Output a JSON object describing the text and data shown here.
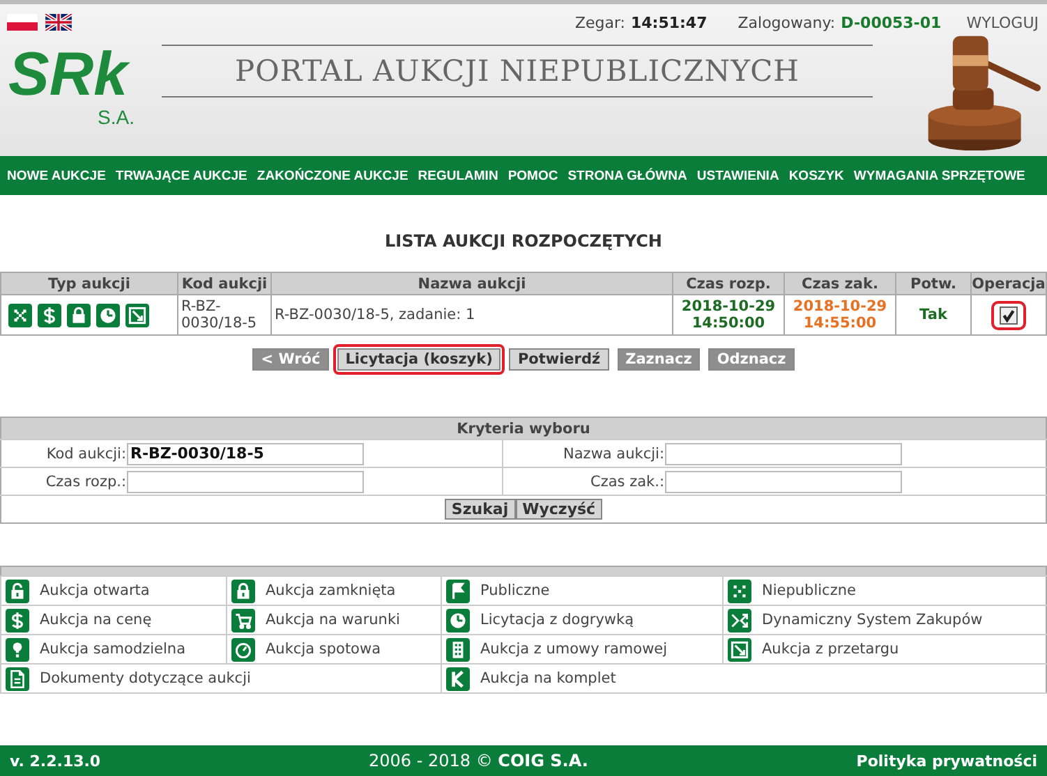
{
  "header": {
    "clock_label": "Zegar:",
    "clock": "14:51:47",
    "user_label": "Zalogowany:",
    "user": "D-00053-01",
    "logout": "WYLOGUJ",
    "logo": {
      "mark": "SRk",
      "suffix": "S.A."
    },
    "title": "PORTAL AUKCJI NIEPUBLICZNYCH"
  },
  "nav": [
    "NOWE AUKCJE",
    "TRWAJĄCE AUKCJE",
    "ZAKOŃCZONE AUKCJE",
    "REGULAMIN",
    "POMOC",
    "STRONA GŁÓWNA",
    "USTAWIENIA",
    "KOSZYK",
    "WYMAGANIA SPRZĘTOWE"
  ],
  "heading": "LISTA AUKCJI ROZPOCZĘTYCH",
  "table": {
    "columns": [
      "Typ aukcji",
      "Kod aukcji",
      "Nazwa aukcji",
      "Czas rozp.",
      "Czas zak.",
      "Potw.",
      "Operacja"
    ],
    "rows": [
      {
        "code": "R-BZ-0030/18-5",
        "name": "R-BZ-0030/18-5, zadanie: 1",
        "start": "2018-10-29 14:50:00",
        "end": "2018-10-29 14:55:00",
        "confirmed": "Tak",
        "checked": true,
        "highlighted": true
      }
    ]
  },
  "buttons": [
    {
      "label": "< Wróć",
      "kind": "muted",
      "highlighted": false
    },
    {
      "label": "Licytacja (koszyk)",
      "kind": "normal",
      "highlighted": true
    },
    {
      "label": "Potwierdź",
      "kind": "normal",
      "highlighted": false
    },
    {
      "label": "Zaznacz",
      "kind": "muted",
      "highlighted": false
    },
    {
      "label": "Odznacz",
      "kind": "muted",
      "highlighted": false
    }
  ],
  "criteria": {
    "title": "Kryteria wyboru",
    "fields": [
      {
        "label": "Kod aukcji:",
        "value": "R-BZ-0030/18-5"
      },
      {
        "label": "Nazwa aukcji:"
      },
      {
        "label": "Czas rozp.:"
      },
      {
        "label": "Czas zak.:"
      }
    ],
    "buttons": [
      "Szukaj",
      "Wyczyść"
    ]
  },
  "legend": [
    [
      "Aukcja otwarta",
      "Aukcja zamknięta",
      "Publiczne",
      "Niepubliczne"
    ],
    [
      "Aukcja na cenę",
      "Aukcja na warunki",
      "Licytacja z dogrywką",
      "Dynamiczny System Zakupów"
    ],
    [
      "Aukcja samodzielna",
      "Aukcja spotowa",
      "Aukcja z umowy ramowej",
      "Aukcja z przetargu"
    ],
    [
      "Dokumenty dotyczące aukcji",
      "Aukcja na komplet"
    ]
  ],
  "footer": {
    "version": "v. 2.2.13.0",
    "copyright": "2006 - 2018 © **COIG S.A.**",
    "privacy": "Polityka prywatności"
  }
}
